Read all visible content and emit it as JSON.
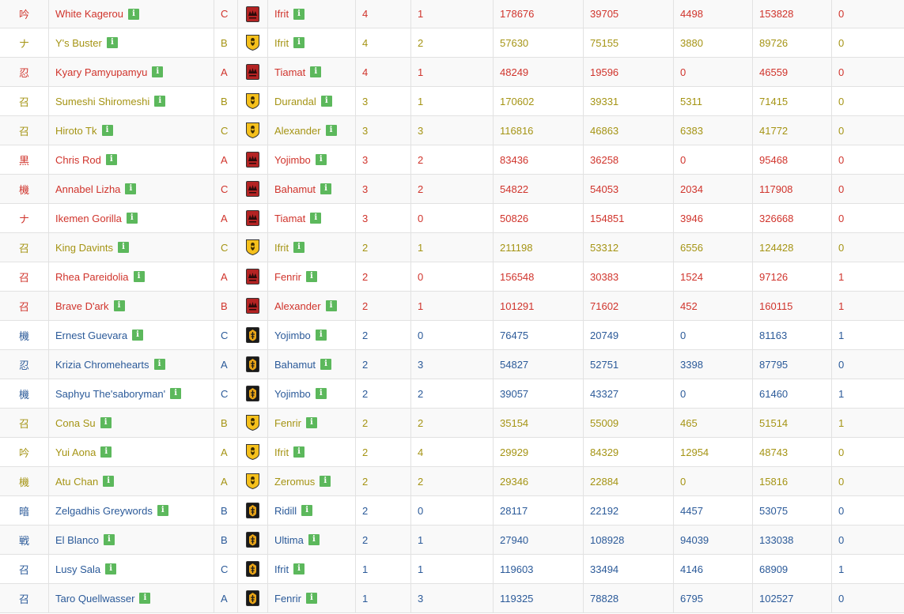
{
  "colors": {
    "red": "#d0342c",
    "olive": "#a59414",
    "blue": "#2b5a99",
    "info_badge": "#5cb85c",
    "gc_maelstrom_bg": "#b42323",
    "gc_adders_bg": "#f5c01c",
    "gc_flames_bg": "#1a1a1a"
  },
  "rows": [
    {
      "job": "吟",
      "name": "White Kagerou",
      "rank": "C",
      "gc": "maelstrom",
      "gc_icon": "maelstrom-emblem-icon",
      "world": "Ifrit",
      "n1": "4",
      "n2": "1",
      "n3": "178676",
      "n4": "39705",
      "n5": "4498",
      "n6": "153828",
      "n7": "0",
      "color": "red"
    },
    {
      "job": "ナ",
      "name": "Y's Buster",
      "rank": "B",
      "gc": "adders",
      "gc_icon": "twin-adder-emblem-icon",
      "world": "Ifrit",
      "n1": "4",
      "n2": "2",
      "n3": "57630",
      "n4": "75155",
      "n5": "3880",
      "n6": "89726",
      "n7": "0",
      "color": "olive"
    },
    {
      "job": "忍",
      "name": "Kyary Pamyupamyu",
      "rank": "A",
      "gc": "maelstrom",
      "gc_icon": "maelstrom-emblem-icon",
      "world": "Tiamat",
      "n1": "4",
      "n2": "1",
      "n3": "48249",
      "n4": "19596",
      "n5": "0",
      "n6": "46559",
      "n7": "0",
      "color": "red"
    },
    {
      "job": "召",
      "name": "Sumeshi Shiromeshi",
      "rank": "B",
      "gc": "adders",
      "gc_icon": "twin-adder-emblem-icon",
      "world": "Durandal",
      "n1": "3",
      "n2": "1",
      "n3": "170602",
      "n4": "39331",
      "n5": "5311",
      "n6": "71415",
      "n7": "0",
      "color": "olive"
    },
    {
      "job": "召",
      "name": "Hiroto Tk",
      "rank": "C",
      "gc": "adders",
      "gc_icon": "twin-adder-emblem-icon",
      "world": "Alexander",
      "n1": "3",
      "n2": "3",
      "n3": "116816",
      "n4": "46863",
      "n5": "6383",
      "n6": "41772",
      "n7": "0",
      "color": "olive"
    },
    {
      "job": "黒",
      "name": "Chris Rod",
      "rank": "A",
      "gc": "maelstrom",
      "gc_icon": "maelstrom-emblem-icon",
      "world": "Yojimbo",
      "n1": "3",
      "n2": "2",
      "n3": "83436",
      "n4": "36258",
      "n5": "0",
      "n6": "95468",
      "n7": "0",
      "color": "red"
    },
    {
      "job": "機",
      "name": "Annabel Lizha",
      "rank": "C",
      "gc": "maelstrom",
      "gc_icon": "maelstrom-emblem-icon",
      "world": "Bahamut",
      "n1": "3",
      "n2": "2",
      "n3": "54822",
      "n4": "54053",
      "n5": "2034",
      "n6": "117908",
      "n7": "0",
      "color": "red"
    },
    {
      "job": "ナ",
      "name": "Ikemen Gorilla",
      "rank": "A",
      "gc": "maelstrom",
      "gc_icon": "maelstrom-emblem-icon",
      "world": "Tiamat",
      "n1": "3",
      "n2": "0",
      "n3": "50826",
      "n4": "154851",
      "n5": "3946",
      "n6": "326668",
      "n7": "0",
      "color": "red"
    },
    {
      "job": "召",
      "name": "King Davints",
      "rank": "C",
      "gc": "adders",
      "gc_icon": "twin-adder-emblem-icon",
      "world": "Ifrit",
      "n1": "2",
      "n2": "1",
      "n3": "211198",
      "n4": "53312",
      "n5": "6556",
      "n6": "124428",
      "n7": "0",
      "color": "olive"
    },
    {
      "job": "召",
      "name": "Rhea Pareidolia",
      "rank": "A",
      "gc": "maelstrom",
      "gc_icon": "maelstrom-emblem-icon",
      "world": "Fenrir",
      "n1": "2",
      "n2": "0",
      "n3": "156548",
      "n4": "30383",
      "n5": "1524",
      "n6": "97126",
      "n7": "1",
      "color": "red"
    },
    {
      "job": "召",
      "name": "Brave D'ark",
      "rank": "B",
      "gc": "maelstrom",
      "gc_icon": "maelstrom-emblem-icon",
      "world": "Alexander",
      "n1": "2",
      "n2": "1",
      "n3": "101291",
      "n4": "71602",
      "n5": "452",
      "n6": "160115",
      "n7": "1",
      "color": "red"
    },
    {
      "job": "機",
      "name": "Ernest Guevara",
      "rank": "C",
      "gc": "flames",
      "gc_icon": "immortal-flames-emblem-icon",
      "world": "Yojimbo",
      "n1": "2",
      "n2": "0",
      "n3": "76475",
      "n4": "20749",
      "n5": "0",
      "n6": "81163",
      "n7": "1",
      "color": "blue"
    },
    {
      "job": "忍",
      "name": "Krizia Chromehearts",
      "rank": "A",
      "gc": "flames",
      "gc_icon": "immortal-flames-emblem-icon",
      "world": "Bahamut",
      "n1": "2",
      "n2": "3",
      "n3": "54827",
      "n4": "52751",
      "n5": "3398",
      "n6": "87795",
      "n7": "0",
      "color": "blue"
    },
    {
      "job": "機",
      "name": "Saphyu The'saboryman'",
      "rank": "C",
      "gc": "flames",
      "gc_icon": "immortal-flames-emblem-icon",
      "world": "Yojimbo",
      "n1": "2",
      "n2": "2",
      "n3": "39057",
      "n4": "43327",
      "n5": "0",
      "n6": "61460",
      "n7": "1",
      "color": "blue"
    },
    {
      "job": "召",
      "name": "Cona Su",
      "rank": "B",
      "gc": "adders",
      "gc_icon": "twin-adder-emblem-icon",
      "world": "Fenrir",
      "n1": "2",
      "n2": "2",
      "n3": "35154",
      "n4": "55009",
      "n5": "465",
      "n6": "51514",
      "n7": "1",
      "color": "olive"
    },
    {
      "job": "吟",
      "name": "Yui Aona",
      "rank": "A",
      "gc": "adders",
      "gc_icon": "twin-adder-emblem-icon",
      "world": "Ifrit",
      "n1": "2",
      "n2": "4",
      "n3": "29929",
      "n4": "84329",
      "n5": "12954",
      "n6": "48743",
      "n7": "0",
      "color": "olive"
    },
    {
      "job": "機",
      "name": "Atu Chan",
      "rank": "A",
      "gc": "adders",
      "gc_icon": "twin-adder-emblem-icon",
      "world": "Zeromus",
      "n1": "2",
      "n2": "2",
      "n3": "29346",
      "n4": "22884",
      "n5": "0",
      "n6": "15816",
      "n7": "0",
      "color": "olive"
    },
    {
      "job": "暗",
      "name": "Zelgadhis Greywords",
      "rank": "B",
      "gc": "flames",
      "gc_icon": "immortal-flames-emblem-icon",
      "world": "Ridill",
      "n1": "2",
      "n2": "0",
      "n3": "28117",
      "n4": "22192",
      "n5": "4457",
      "n6": "53075",
      "n7": "0",
      "color": "blue"
    },
    {
      "job": "戦",
      "name": "El Blanco",
      "rank": "B",
      "gc": "flames",
      "gc_icon": "immortal-flames-emblem-icon",
      "world": "Ultima",
      "n1": "2",
      "n2": "1",
      "n3": "27940",
      "n4": "108928",
      "n5": "94039",
      "n6": "133038",
      "n7": "0",
      "color": "blue"
    },
    {
      "job": "召",
      "name": "Lusy Sala",
      "rank": "C",
      "gc": "flames",
      "gc_icon": "immortal-flames-emblem-icon",
      "world": "Ifrit",
      "n1": "1",
      "n2": "1",
      "n3": "119603",
      "n4": "33494",
      "n5": "4146",
      "n6": "68909",
      "n7": "1",
      "color": "blue"
    },
    {
      "job": "召",
      "name": "Taro Quellwasser",
      "rank": "A",
      "gc": "flames",
      "gc_icon": "immortal-flames-emblem-icon",
      "world": "Fenrir",
      "n1": "1",
      "n2": "3",
      "n3": "119325",
      "n4": "78828",
      "n5": "6795",
      "n6": "102527",
      "n7": "0",
      "color": "blue"
    }
  ],
  "info_badge_glyph": "i"
}
